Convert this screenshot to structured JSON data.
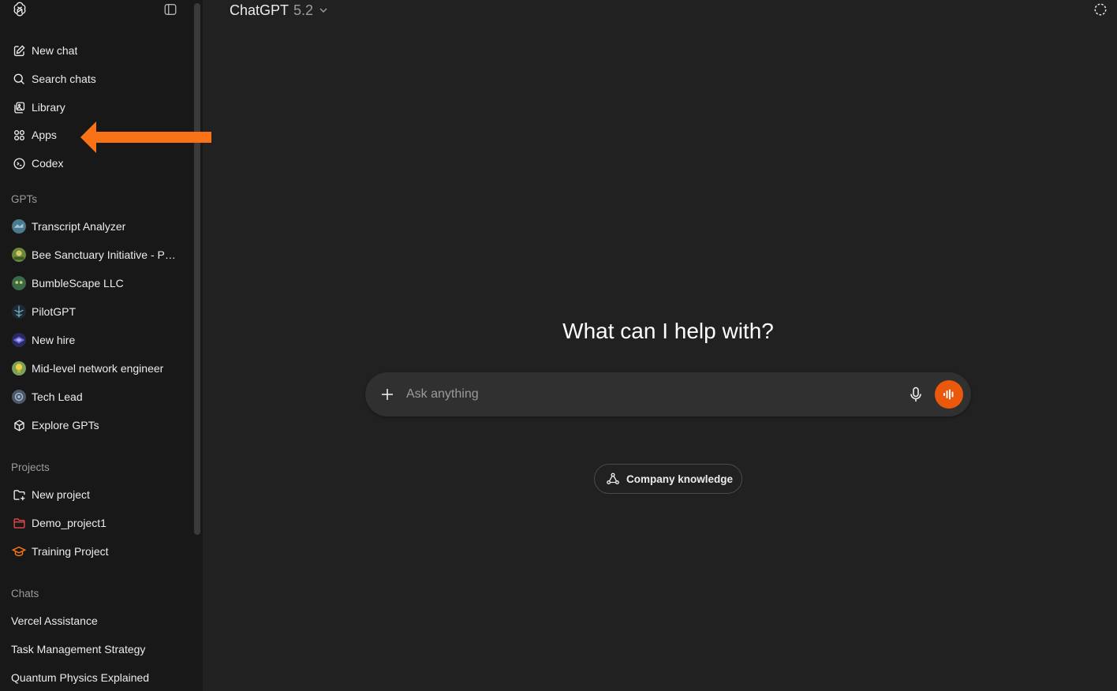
{
  "sidebar": {
    "nav": [
      {
        "label": "New chat",
        "icon": "edit-icon"
      },
      {
        "label": "Search chats",
        "icon": "search-icon"
      },
      {
        "label": "Library",
        "icon": "library-icon"
      },
      {
        "label": "Apps",
        "icon": "apps-icon"
      },
      {
        "label": "Codex",
        "icon": "codex-icon"
      }
    ],
    "gpts_title": "GPTs",
    "gpts": [
      {
        "label": "Transcript Analyzer",
        "color": "#4a7a8c"
      },
      {
        "label": "Bee Sanctuary Initiative - Par...",
        "color": "#6a8a3a"
      },
      {
        "label": "BumbleScape LLC",
        "color": "#3a6a4a"
      },
      {
        "label": "PilotGPT",
        "color": "#2a4a5a"
      },
      {
        "label": "New hire",
        "color": "#4a4aa0"
      },
      {
        "label": "Mid-level network engineer",
        "color": "#c8b040"
      },
      {
        "label": "Tech Lead",
        "color": "#6a7a8a"
      }
    ],
    "explore_label": "Explore GPTs",
    "projects_title": "Projects",
    "projects": [
      {
        "label": "New project",
        "icon": "folder-plus-icon",
        "color": "#ececec"
      },
      {
        "label": "Demo_project1",
        "icon": "folder-icon",
        "color": "#e5484d"
      },
      {
        "label": "Training Project",
        "icon": "graduation-cap-icon",
        "color": "#f97316"
      }
    ],
    "chats_title": "Chats",
    "chats": [
      {
        "label": "Vercel Assistance"
      },
      {
        "label": "Task Management Strategy"
      },
      {
        "label": "Quantum Physics Explained"
      }
    ]
  },
  "header": {
    "model_name": "ChatGPT",
    "model_version": "5.2"
  },
  "main": {
    "headline": "What can I help with?",
    "composer_placeholder": "Ask anything",
    "chip_label": "Company knowledge"
  },
  "colors": {
    "accent": "#ea580c",
    "arrow": "#f97316",
    "sidebar_bg": "#181818",
    "main_bg": "#212121"
  }
}
